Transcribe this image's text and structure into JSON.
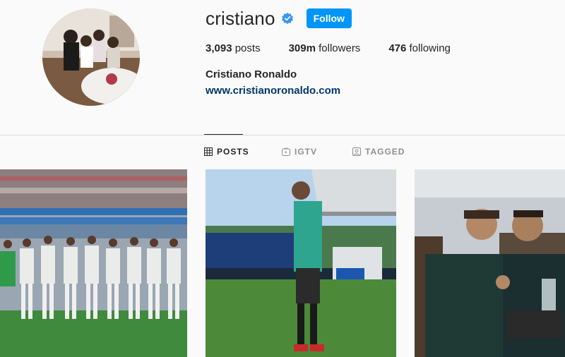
{
  "profile": {
    "username": "cristiano",
    "follow_label": "Follow",
    "posts_count": "3,093",
    "posts_label": "posts",
    "followers_count": "309m",
    "followers_label": "followers",
    "following_count": "476",
    "following_label": "following",
    "full_name": "Cristiano Ronaldo",
    "website": "www.cristianoronaldo.com"
  },
  "tabs": [
    {
      "label": "POSTS",
      "icon": "grid-icon",
      "active": true
    },
    {
      "label": "IGTV",
      "icon": "igtv-icon",
      "active": false
    },
    {
      "label": "TAGGED",
      "icon": "tagged-icon",
      "active": false
    }
  ],
  "colors": {
    "accent": "#0095f6",
    "link": "#00376b",
    "verified": "#3897f0"
  }
}
